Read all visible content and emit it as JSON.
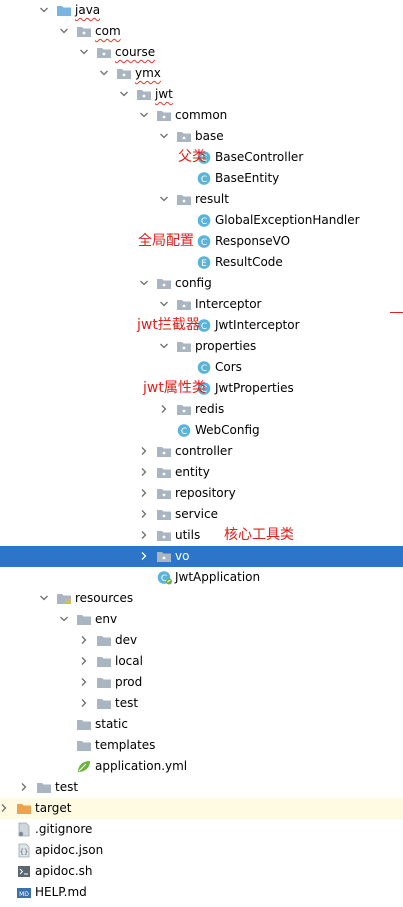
{
  "tree": [
    {
      "label": "java",
      "depth": 3,
      "arrow": "down",
      "icon": "folder-src",
      "squiggle": true
    },
    {
      "label": "com",
      "depth": 4,
      "arrow": "down",
      "icon": "package",
      "squiggle": true
    },
    {
      "label": "course",
      "depth": 5,
      "arrow": "down",
      "icon": "package",
      "squiggle": true
    },
    {
      "label": "ymx",
      "depth": 6,
      "arrow": "down",
      "icon": "package",
      "squiggle": true
    },
    {
      "label": "jwt",
      "depth": 7,
      "arrow": "down",
      "icon": "package",
      "squiggle": true
    },
    {
      "label": "common",
      "depth": 8,
      "arrow": "down",
      "icon": "package"
    },
    {
      "label": "base",
      "depth": 9,
      "arrow": "down",
      "icon": "package"
    },
    {
      "label": "BaseController",
      "depth": 10,
      "arrow": "none",
      "icon": "class"
    },
    {
      "label": "BaseEntity",
      "depth": 10,
      "arrow": "none",
      "icon": "class"
    },
    {
      "label": "result",
      "depth": 9,
      "arrow": "down",
      "icon": "package"
    },
    {
      "label": "GlobalExceptionHandler",
      "depth": 10,
      "arrow": "none",
      "icon": "class"
    },
    {
      "label": "ResponseVO",
      "depth": 10,
      "arrow": "none",
      "icon": "class"
    },
    {
      "label": "ResultCode",
      "depth": 10,
      "arrow": "none",
      "icon": "enum"
    },
    {
      "label": "config",
      "depth": 8,
      "arrow": "down",
      "icon": "package"
    },
    {
      "label": "Interceptor",
      "depth": 9,
      "arrow": "down",
      "icon": "package"
    },
    {
      "label": "JwtInterceptor",
      "depth": 10,
      "arrow": "none",
      "icon": "class"
    },
    {
      "label": "properties",
      "depth": 9,
      "arrow": "down",
      "icon": "package"
    },
    {
      "label": "Cors",
      "depth": 10,
      "arrow": "none",
      "icon": "class"
    },
    {
      "label": "JwtProperties",
      "depth": 10,
      "arrow": "none",
      "icon": "class"
    },
    {
      "label": "redis",
      "depth": 9,
      "arrow": "right",
      "icon": "package"
    },
    {
      "label": "WebConfig",
      "depth": 9,
      "arrow": "none",
      "icon": "class"
    },
    {
      "label": "controller",
      "depth": 8,
      "arrow": "right",
      "icon": "package"
    },
    {
      "label": "entity",
      "depth": 8,
      "arrow": "right",
      "icon": "package"
    },
    {
      "label": "repository",
      "depth": 8,
      "arrow": "right",
      "icon": "package"
    },
    {
      "label": "service",
      "depth": 8,
      "arrow": "right",
      "icon": "package"
    },
    {
      "label": "utils",
      "depth": 8,
      "arrow": "right",
      "icon": "package"
    },
    {
      "label": "vo",
      "depth": 8,
      "arrow": "right",
      "icon": "package",
      "selected": true
    },
    {
      "label": "JwtApplication",
      "depth": 8,
      "arrow": "none",
      "icon": "spring-class"
    },
    {
      "label": "resources",
      "depth": 3,
      "arrow": "down",
      "icon": "folder-res"
    },
    {
      "label": "env",
      "depth": 4,
      "arrow": "down",
      "icon": "folder"
    },
    {
      "label": "dev",
      "depth": 5,
      "arrow": "right",
      "icon": "folder"
    },
    {
      "label": "local",
      "depth": 5,
      "arrow": "right",
      "icon": "folder"
    },
    {
      "label": "prod",
      "depth": 5,
      "arrow": "right",
      "icon": "folder"
    },
    {
      "label": "test",
      "depth": 5,
      "arrow": "right",
      "icon": "folder"
    },
    {
      "label": "static",
      "depth": 4,
      "arrow": "none",
      "icon": "folder"
    },
    {
      "label": "templates",
      "depth": 4,
      "arrow": "none",
      "icon": "folder"
    },
    {
      "label": "application.yml",
      "depth": 4,
      "arrow": "none",
      "icon": "yml"
    },
    {
      "label": "test",
      "depth": 2,
      "arrow": "right",
      "icon": "folder"
    },
    {
      "label": "target",
      "depth": 1,
      "arrow": "right",
      "icon": "folder-excluded",
      "highlight": true
    },
    {
      "label": ".gitignore",
      "depth": 1,
      "arrow": "none",
      "icon": "file-text"
    },
    {
      "label": "apidoc.json",
      "depth": 1,
      "arrow": "none",
      "icon": "file-json"
    },
    {
      "label": "apidoc.sh",
      "depth": 1,
      "arrow": "none",
      "icon": "file-sh"
    },
    {
      "label": "HELP.md",
      "depth": 1,
      "arrow": "none",
      "icon": "file-md"
    }
  ],
  "annotations": [
    {
      "text": "父类",
      "row": 7
    },
    {
      "text": "全局配置",
      "row": 11
    },
    {
      "text": "jwt拦截器",
      "row": 15
    },
    {
      "text": "jwt属性类",
      "row": 18
    },
    {
      "text": "核心工具类",
      "row": 25
    }
  ],
  "colors": {
    "folder": "#a9b6c1",
    "folder-src": "#7ab4e0",
    "folder-res": "#a9b6c1",
    "folder-excluded": "#f0a14a",
    "class": "#5ab3d8",
    "enum": "#5ab3d8",
    "annotation": "#e0201c",
    "selection": "#2c75c8"
  },
  "icon_badges": {
    "class_letter": "C",
    "enum_letter": "E",
    "md_letter": "MD"
  }
}
